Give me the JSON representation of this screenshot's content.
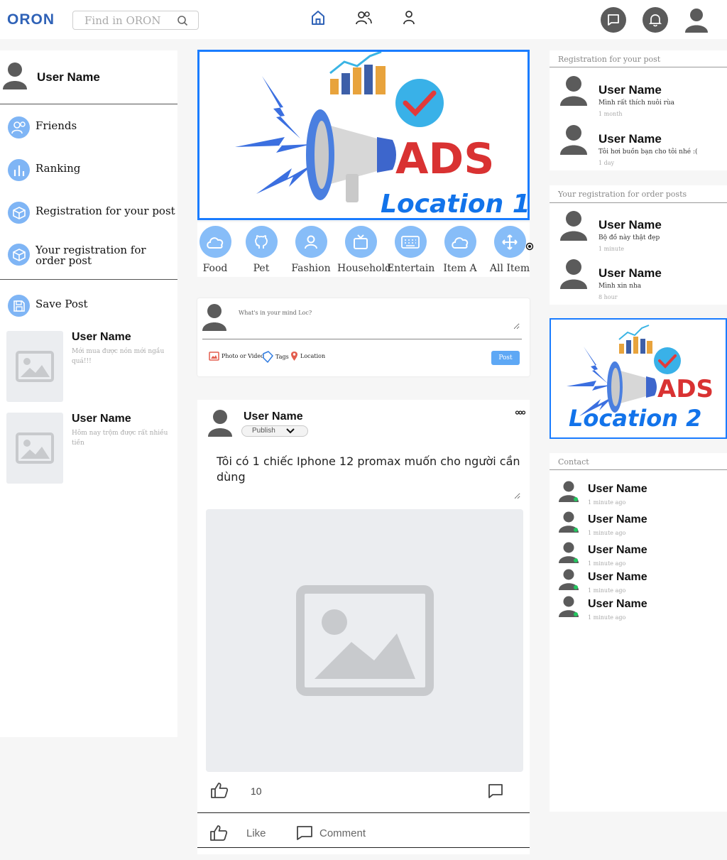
{
  "header": {
    "logo": "ORON",
    "search_placeholder": "Find in ORON"
  },
  "left": {
    "user_name": "User Name",
    "menu": [
      {
        "label": "Friends",
        "icon": "friends-icon"
      },
      {
        "label": "Ranking",
        "icon": "ranking-icon"
      },
      {
        "label": "Registration for your post",
        "icon": "box-icon"
      },
      {
        "label": "Your registration for order post",
        "icon": "box-icon"
      }
    ],
    "save_post": "Save Post",
    "saved": [
      {
        "title": "User Name",
        "desc": "Mới mua được nón mới ngầu quá!!!"
      },
      {
        "title": "User Name",
        "desc": "Hôm nay trộm được rất nhiều tiền"
      }
    ]
  },
  "ads": {
    "ad1_brand": "ADS",
    "ad1_location": "Location 1",
    "ad2_brand": "ADS",
    "ad2_location": "Location 2"
  },
  "categories": [
    {
      "label": "Food",
      "icon": "cloud-icon"
    },
    {
      "label": "Pet",
      "icon": "github-icon"
    },
    {
      "label": "Fashion",
      "icon": "person-icon"
    },
    {
      "label": "Household",
      "icon": "tv-icon"
    },
    {
      "label": "Entertain",
      "icon": "keyboard-icon"
    },
    {
      "label": "Item A",
      "icon": "cloud-icon"
    },
    {
      "label": "All Item",
      "icon": "move-icon"
    }
  ],
  "composer": {
    "placeholder": "What's in your mind Loc?",
    "photo": "Photo or Video",
    "tags": "Tags",
    "location": "Location",
    "post": "Post"
  },
  "post": {
    "user_name": "User Name",
    "visibility": "Publish",
    "text": "Tôi có 1 chiếc Iphone 12 promax muốn cho người cần dùng",
    "likes": "10",
    "like_label": "Like",
    "comment_label": "Comment"
  },
  "right": {
    "registration_title": "Registration for your post",
    "registration": [
      {
        "name": "User Name",
        "msg": "Mình rất thích nuôi rùa",
        "time": "1 month"
      },
      {
        "name": "User Name",
        "msg": "Tôi hơi buồn bạn cho tôi nhé :(",
        "time": "1 day"
      }
    ],
    "order_title": "Your registration for order posts",
    "order": [
      {
        "name": "User Name",
        "msg": "Bộ đồ này thật đẹp",
        "time": "1 minute"
      },
      {
        "name": "User Name",
        "msg": "Mình xin nha",
        "time": "8 hour"
      }
    ],
    "contact_title": "Contact",
    "contacts": [
      {
        "name": "User Name",
        "time": "1 minute ago"
      },
      {
        "name": "User Name",
        "time": "1 minute ago"
      },
      {
        "name": "User Name",
        "time": "1 minute ago"
      },
      {
        "name": "User Name",
        "time": "1 minute ago"
      },
      {
        "name": "User Name",
        "time": "1 minute ago"
      }
    ]
  },
  "colors": {
    "brand": "#2f62b7",
    "accent": "#1a7cff",
    "category_bg": "#87bdf8",
    "sidebar_icon_bg": "#7fb5f5",
    "online": "#22c55e"
  }
}
